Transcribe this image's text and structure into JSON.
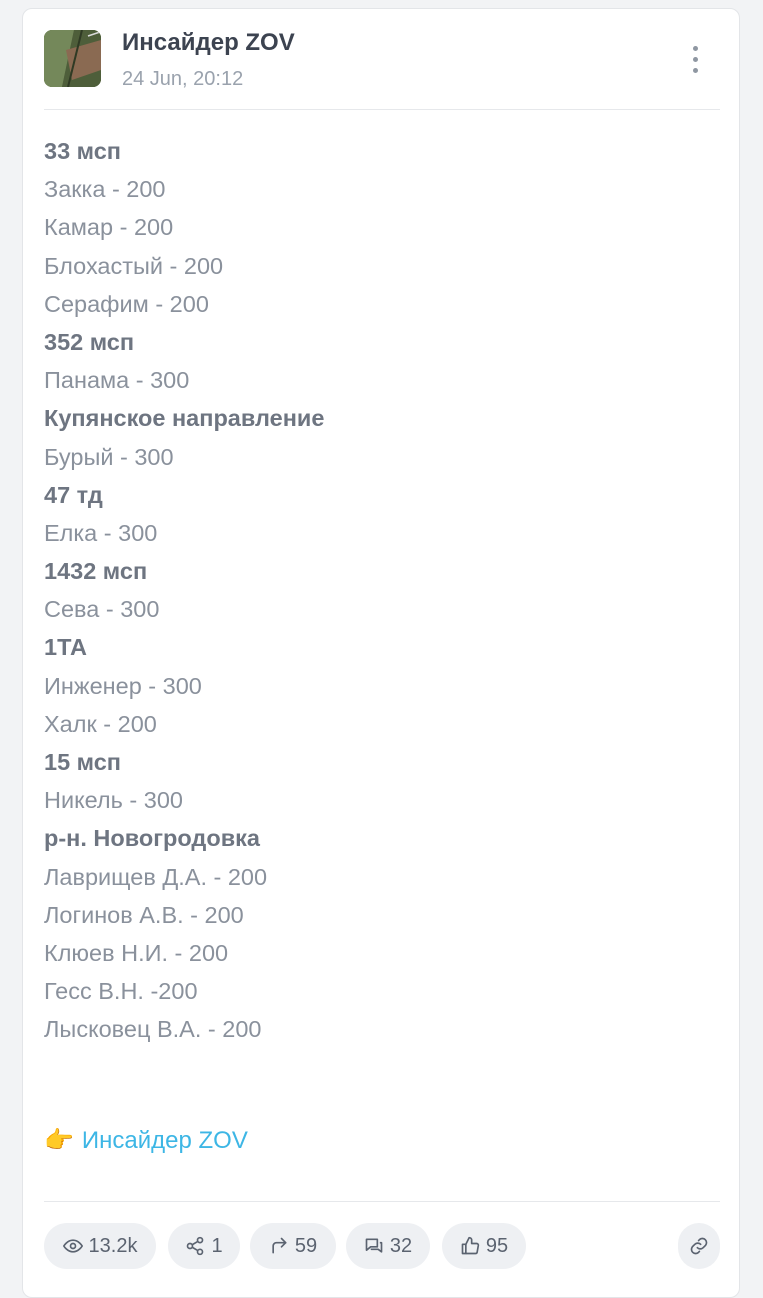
{
  "header": {
    "channel_name": "Инсайдер ZOV",
    "date": "24 Jun, 20:12"
  },
  "post": {
    "lines": [
      {
        "text": "33 мсп",
        "bold": true
      },
      {
        "text": "Закка - 200",
        "bold": false
      },
      {
        "text": "Камар - 200",
        "bold": false
      },
      {
        "text": "Блохастый - 200",
        "bold": false
      },
      {
        "text": "Серафим - 200",
        "bold": false
      },
      {
        "text": "352 мсп",
        "bold": true
      },
      {
        "text": "Панама - 300",
        "bold": false
      },
      {
        "text": "Купянское направление",
        "bold": true
      },
      {
        "text": "Бурый - 300",
        "bold": false
      },
      {
        "text": "47 тд",
        "bold": true
      },
      {
        "text": "Елка - 300",
        "bold": false
      },
      {
        "text": "1432 мсп",
        "bold": true
      },
      {
        "text": "Сева - 300",
        "bold": false
      },
      {
        "text": "1ТА",
        "bold": true
      },
      {
        "text": "Инженер - 300",
        "bold": false
      },
      {
        "text": "Халк - 200",
        "bold": false
      },
      {
        "text": "15 мсп",
        "bold": true
      },
      {
        "text": "Никель - 300",
        "bold": false
      },
      {
        "text": "р-н. Новогродовка",
        "bold": true
      },
      {
        "text": "Лаврищев Д.А. - 200",
        "bold": false
      },
      {
        "text": "Логинов А.В. - 200",
        "bold": false
      },
      {
        "text": "Клюев Н.И. - 200",
        "bold": false
      },
      {
        "text": "Гесс В.Н. -200",
        "bold": false
      },
      {
        "text": "Лысковец В.А. - 200",
        "bold": false
      }
    ],
    "link_icon": "👉",
    "link_text": "Инсайдер ZOV"
  },
  "stats": {
    "views": "13.2k",
    "shares": "1",
    "forwards": "59",
    "comments": "32",
    "likes": "95"
  },
  "colors": {
    "link": "#3db6e5",
    "bold_text": "#6e7581",
    "normal_text": "#8a919c",
    "pill_bg": "#eef0f3"
  },
  "icons": [
    "eye-icon",
    "share-icon",
    "forward-icon",
    "comment-icon",
    "thumbs-up-icon",
    "link-icon",
    "more-vertical-icon"
  ]
}
